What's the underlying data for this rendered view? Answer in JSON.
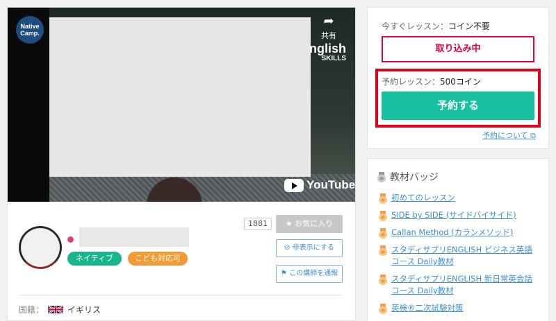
{
  "video": {
    "logo_text": "Native Camp.",
    "share_label": "共有",
    "english_text": "nglish",
    "skills_text": "SKILLS",
    "youtube_text": "YouTube"
  },
  "teacher": {
    "favorite_count": "1881",
    "favorite_label": "お気に入り",
    "tags": [
      "ネイティブ",
      "こども対応可"
    ],
    "hide_label": "非表示にする",
    "report_label": "この講師を通報",
    "nationality_label": "国籍：",
    "nationality_value": "イギリス"
  },
  "booking": {
    "now_label": "今すぐレッスン：",
    "now_value": "コイン不要",
    "loading_label": "取り込み中",
    "reserve_label": "予約レッスン：",
    "reserve_value": "500コイン",
    "reserve_button": "予約する",
    "about_link": "予約について"
  },
  "badges": {
    "title": "教材バッジ",
    "items": [
      "初めてのレッスン",
      "SIDE by SIDE (サイドバイサイド)",
      "Callan Method (カランメソッド)",
      "スタディサプリENGLISH ビジネス英語コース Daily教材",
      "スタディサプリENGLISH 新日常英会話コース Daily教材",
      "英検®二次試験対策"
    ]
  },
  "colors": {
    "accent_green": "#17c19f",
    "alert_red": "#e0003c",
    "link_blue": "#3d8fd1",
    "tag_orange": "#f39a32"
  }
}
